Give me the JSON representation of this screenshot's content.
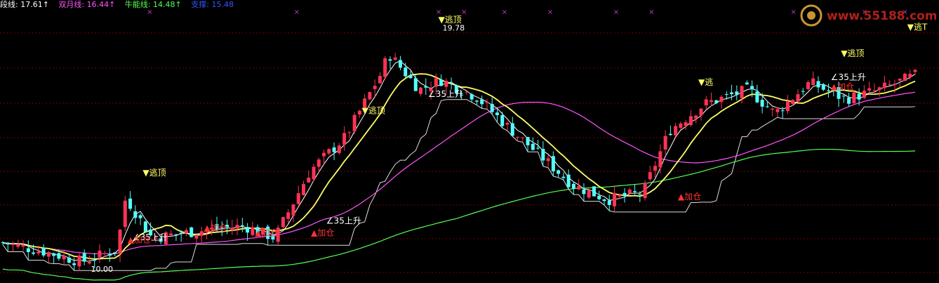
{
  "legend": [
    {
      "label": "段线: 17.61↑",
      "color": "#ffffff"
    },
    {
      "label": "双月线: 16.44↑",
      "color": "#ff55ff"
    },
    {
      "label": "牛能线: 14.48↑",
      "color": "#55ff55"
    },
    {
      "label": "支撑: 15.48",
      "color": "#3355ff"
    }
  ],
  "watermark": {
    "text": "www.55188.com"
  },
  "colors": {
    "up": "#ff3355",
    "down": "#55ffff",
    "short": "#ffffff",
    "mid": "#ffff66",
    "long": "#ff55ff",
    "bull": "#55ff55",
    "signal": "#ff3333",
    "label": "#ffff66",
    "grid": "#7a0000",
    "cross": "#cc33cc"
  },
  "chart_data": {
    "type": "candlestick",
    "ylim": [
      9.2,
      20.3
    ],
    "price_annotations": [
      {
        "text": "19.78",
        "index": 86,
        "price": 19.78
      },
      {
        "text": "10.00",
        "index": 17,
        "price": 10.0
      }
    ],
    "signals": [
      {
        "text": "▼逃顶",
        "index": 28,
        "price": 13.6,
        "kind": "top"
      },
      {
        "text": "▼逃顶",
        "index": 71,
        "price": 16.2,
        "kind": "top"
      },
      {
        "text": "▼逃顶",
        "index": 86,
        "price": 20.0,
        "kind": "top"
      },
      {
        "text": "▼逃",
        "index": 137,
        "price": 17.4,
        "kind": "top"
      },
      {
        "text": "▼逃顶",
        "index": 165,
        "price": 18.6,
        "kind": "top"
      },
      {
        "text": "▼逃T",
        "index": 178,
        "price": 19.7,
        "kind": "top"
      },
      {
        "text": "∠35上升",
        "index": 26,
        "price": 10.9,
        "kind": "rise"
      },
      {
        "text": "∠35上升",
        "index": 84,
        "price": 16.9,
        "kind": "rise"
      },
      {
        "text": "∠35上升",
        "index": 64,
        "price": 11.6,
        "kind": "rise"
      },
      {
        "text": "∠35上升",
        "index": 163,
        "price": 17.6,
        "kind": "rise"
      },
      {
        "text": "▲加仓",
        "index": 61,
        "price": 11.1,
        "kind": "add"
      },
      {
        "text": "▲加仓",
        "index": 133,
        "price": 12.6,
        "kind": "add"
      },
      {
        "text": "▲加仓",
        "index": 25,
        "price": 10.8,
        "kind": "add"
      },
      {
        "text": "▲加仓",
        "index": 40,
        "price": 11.3,
        "kind": "add"
      },
      {
        "text": "▲加仓",
        "index": 50,
        "price": 11.1,
        "kind": "add"
      },
      {
        "text": "▲加仓",
        "index": 163,
        "price": 17.2,
        "kind": "add"
      }
    ]
  }
}
